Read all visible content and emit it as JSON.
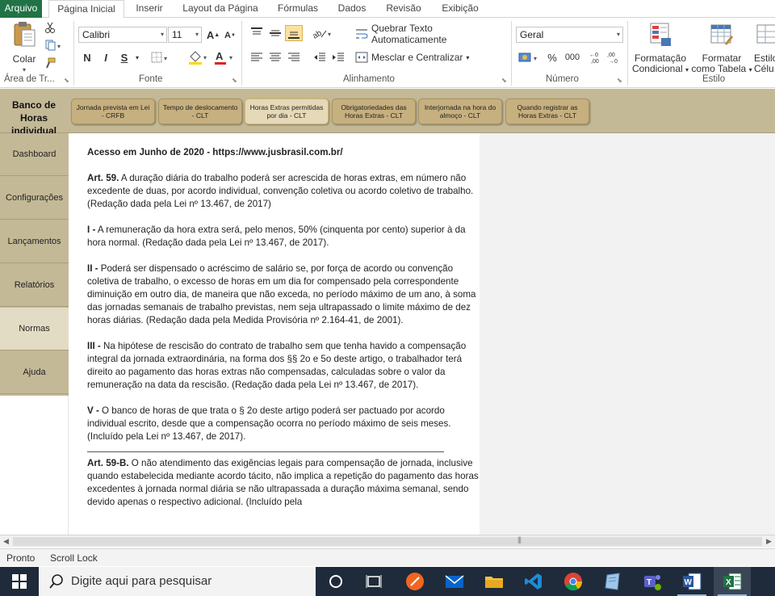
{
  "ribbon_tabs": [
    "Arquivo",
    "Página Inicial",
    "Inserir",
    "Layout da Página",
    "Fórmulas",
    "Dados",
    "Revisão",
    "Exibição"
  ],
  "clipboard": {
    "paste_label": "Colar",
    "group_label": "Área de Tr..."
  },
  "font": {
    "name": "Calibri",
    "size": "11",
    "bold": "N",
    "italic": "I",
    "underline": "S",
    "group_label": "Fonte"
  },
  "alignment": {
    "wrap_label": "Quebrar Texto Automaticamente",
    "merge_label": "Mesclar e Centralizar",
    "group_label": "Alinhamento"
  },
  "number": {
    "format": "Geral",
    "group_label": "Número"
  },
  "styles": {
    "cond_format": [
      "Formatação",
      "Condicional"
    ],
    "format_table": [
      "Formatar",
      "como Tabela"
    ],
    "cell_styles": [
      "Estilo",
      "Célu"
    ],
    "group_label": "Estilo"
  },
  "band": {
    "title": "Banco de Horas individual",
    "buttons": [
      {
        "label": "Jornada prevista em Lei - CRFB",
        "selected": false
      },
      {
        "label": "Tempo de deslocamento - CLT",
        "selected": false
      },
      {
        "label": "Horas Extras permitidas por dia - CLT",
        "selected": true
      },
      {
        "label": "Obrigatoriedades das Horas Extras - CLT",
        "selected": false
      },
      {
        "label": "Interjornada na hora do almoço - CLT",
        "selected": false
      },
      {
        "label": "Quando registrar as Horas Extras - CLT",
        "selected": false
      }
    ]
  },
  "side_menu": [
    {
      "label": "Dashboard",
      "selected": false
    },
    {
      "label": "Configurações",
      "selected": false
    },
    {
      "label": "Lançamentos",
      "selected": false
    },
    {
      "label": "Relatórios",
      "selected": false
    },
    {
      "label": "Normas",
      "selected": true
    },
    {
      "label": "Ajuda",
      "selected": false
    }
  ],
  "doc": {
    "source": "Acesso em Junho de 2020 - https://www.jusbrasil.com.br/",
    "art59_label": "Art. 59.",
    "art59_text": " A duração diária do trabalho poderá ser acrescida de horas extras, em número não excedente de duas, por acordo individual, convenção coletiva ou acordo coletivo de trabalho. (Redação dada pela Lei nº 13.467, de 2017)",
    "i_label": "I -",
    "i_text": " A remuneração da hora extra será, pelo menos, 50% (cinquenta por cento) superior à da hora normal. (Redação dada pela Lei nº 13.467, de 2017).",
    "ii_label": "II -",
    "ii_text": " Poderá ser dispensado o acréscimo de salário se, por força de acordo ou convenção coletiva de trabalho, o excesso de horas em um dia for compensado pela correspondente diminuição em outro dia, de maneira que não exceda, no período máximo de um ano, à soma das jornadas semanais de trabalho previstas, nem seja ultrapassado o limite máximo de dez horas diárias. (Redação dada pela Medida Provisória nº 2.164-41, de 2001).",
    "iii_label": "III -",
    "iii_text": " Na hipótese de rescisão do contrato de trabalho sem que tenha havido a compensação integral da jornada extraordinária, na forma dos §§ 2o e 5o deste artigo, o trabalhador terá direito ao pagamento das horas extras não compensadas, calculadas sobre o valor da remuneração na data da rescisão. (Redação dada pela Lei nº 13.467, de 2017).",
    "v_label": "V -",
    "v_text": " O banco de horas de que trata o § 2o deste artigo poderá ser pactuado por acordo individual escrito, desde que a compensação ocorra no período máximo de seis meses. (Incluído pela Lei nº 13.467, de 2017).",
    "art59b_label": "Art. 59-B.",
    "art59b_text": " O não atendimento das exigências legais para compensação de jornada, inclusive quando estabelecida mediante acordo tácito, não implica a repetição do pagamento das horas excedentes à jornada normal diária se não ultrapassada a duração máxima semanal, sendo devido apenas o respectivo adicional. (Incluído pela"
  },
  "status": {
    "ready": "Pronto",
    "scroll_lock": "Scroll Lock"
  },
  "taskbar": {
    "search_placeholder": "Digite aqui para pesquisar"
  },
  "colors": {
    "excel_green": "#217346",
    "band_bg": "#c4b997",
    "button_bg": "#c7b07f",
    "selected_side": "#e3dcc5",
    "taskbar": "#1f2b3a"
  }
}
